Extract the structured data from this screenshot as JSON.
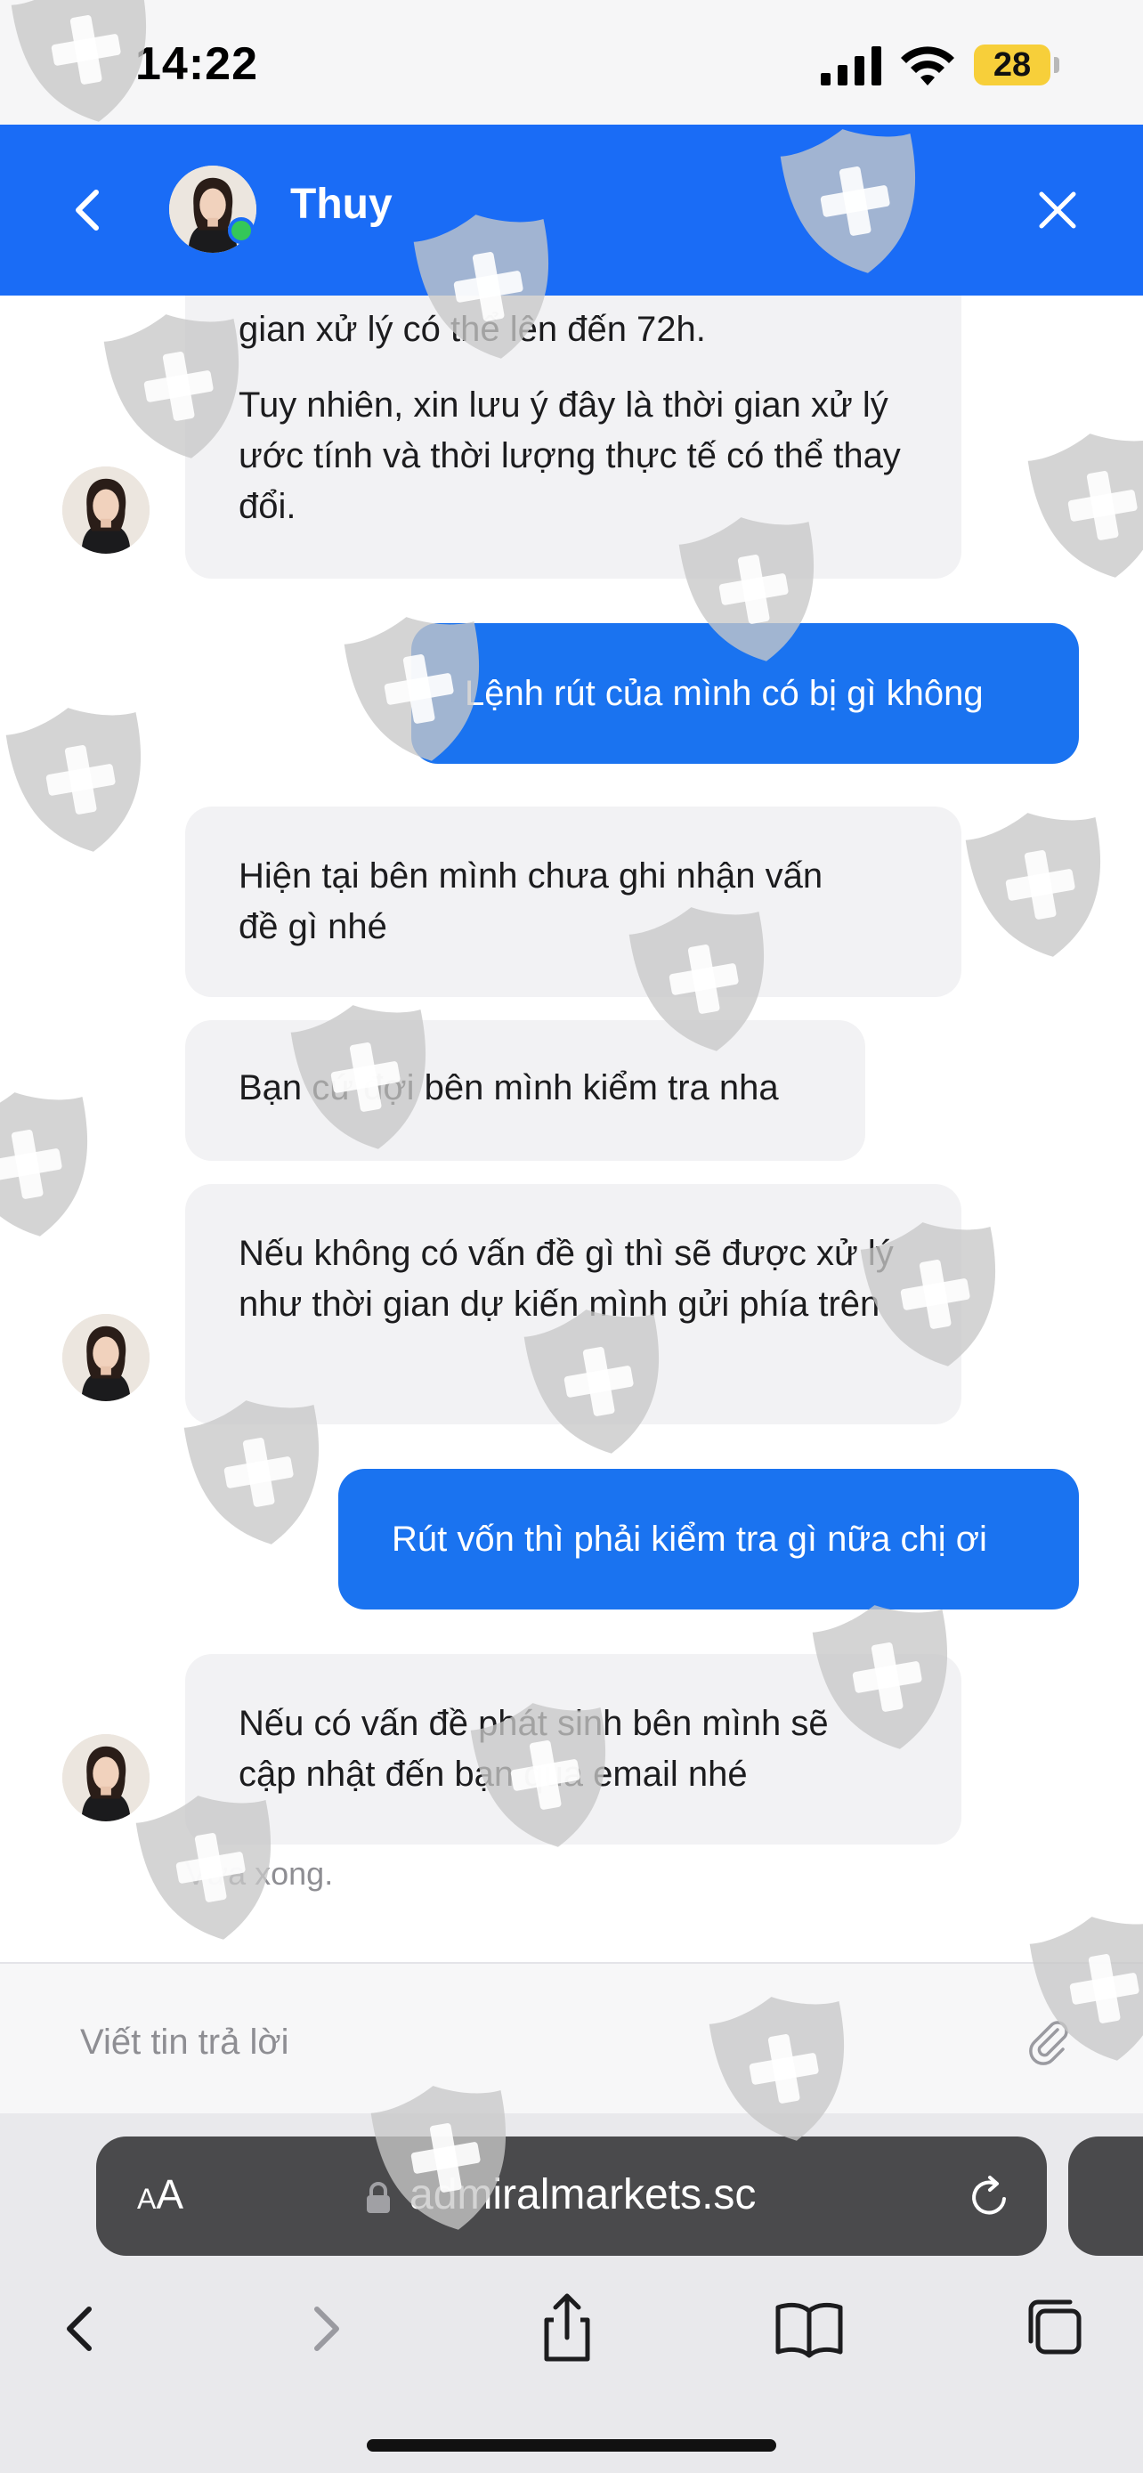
{
  "status_bar": {
    "time": "14:22",
    "battery_level": "28",
    "signal_icon": "cellular-signal-icon",
    "wifi_icon": "wifi-icon"
  },
  "chat_header": {
    "contact_name": "Thuy",
    "online_status_color": "#34c759",
    "back_icon": "chevron-left-icon",
    "close_icon": "close-icon",
    "background_color": "#1a6cf6"
  },
  "messages": [
    {
      "from": "agent",
      "paragraphs": [
        "gian xử lý có thể lên đến 72h.",
        "Tuy nhiên, xin lưu ý đây là thời gian xử lý ước tính và thời lượng thực tế có thể thay đổi."
      ]
    },
    {
      "from": "user",
      "text": "Lệnh rút của mình có bị gì không"
    },
    {
      "from": "agent",
      "text": "Hiện tại bên mình chưa ghi nhận vấn đề gì nhé"
    },
    {
      "from": "agent",
      "text": "Bạn cứ đợi bên mình kiểm tra nha"
    },
    {
      "from": "agent",
      "text": "Nếu không có vấn đề gì thì sẽ được xử lý như thời gian dự kiến mình gửi phía trên"
    },
    {
      "from": "user",
      "text": "Rút vốn thì phải kiểm tra gì nữa chị ơi"
    },
    {
      "from": "agent",
      "text": "Nếu có vấn đề phát sinh bên mình sẽ cập nhật đến bạn qua email nhé"
    }
  ],
  "last_message_time": "Vừa xong.",
  "reply": {
    "placeholder": "Viết tin trả lời",
    "value": "",
    "attach_icon": "paperclip-icon"
  },
  "browser": {
    "text_size_label_small": "A",
    "text_size_label_large": "A",
    "url": "admiralmarkets.sc",
    "lock_icon": "lock-icon",
    "reload_icon": "reload-icon",
    "toolbar_icons": [
      "back-icon",
      "forward-icon",
      "share-icon",
      "bookmarks-icon",
      "tabs-icon"
    ]
  },
  "colors": {
    "accent": "#1a73f0",
    "incoming_bubble": "#f2f2f4",
    "watermark": "#c8c8c8"
  }
}
